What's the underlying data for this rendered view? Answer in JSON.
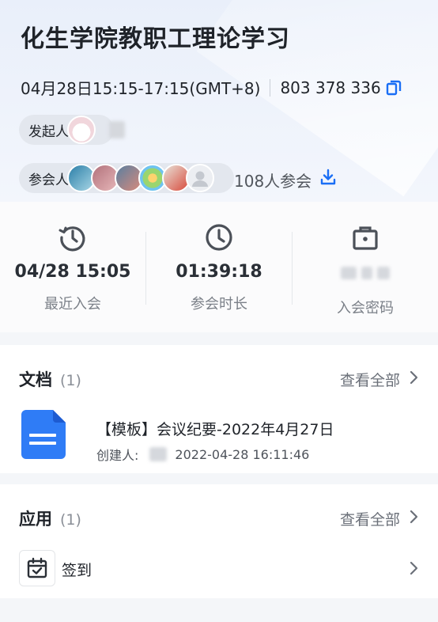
{
  "meeting": {
    "title": "化生学院教职工理论学习",
    "time": "04月28日15:15-17:15(GMT+8)",
    "meeting_id": "803 378 336"
  },
  "host": {
    "label": "发起人"
  },
  "participants": {
    "label": "参会人",
    "count_text": "108人参会"
  },
  "stats": [
    {
      "value": "04/28 15:05",
      "label": "最近入会",
      "icon": "history-icon"
    },
    {
      "value": "01:39:18",
      "label": "参会时长",
      "icon": "clock-icon"
    },
    {
      "value": "",
      "label": "入会密码",
      "icon": "lock-icon"
    }
  ],
  "documents": {
    "title": "文档",
    "count": "(1)",
    "view_all": "查看全部",
    "items": [
      {
        "title": "【模板】会议纪要-2022年4月27日",
        "creator_label": "创建人:",
        "created_at": "2022-04-28 16:11:46"
      }
    ]
  },
  "apps": {
    "title": "应用",
    "count": "(1)",
    "view_all": "查看全部",
    "items": [
      {
        "label": "签到",
        "icon": "check-in-icon"
      }
    ]
  },
  "colors": {
    "accent": "#1a6ef5",
    "doc_blue": "#2f7cf6"
  }
}
